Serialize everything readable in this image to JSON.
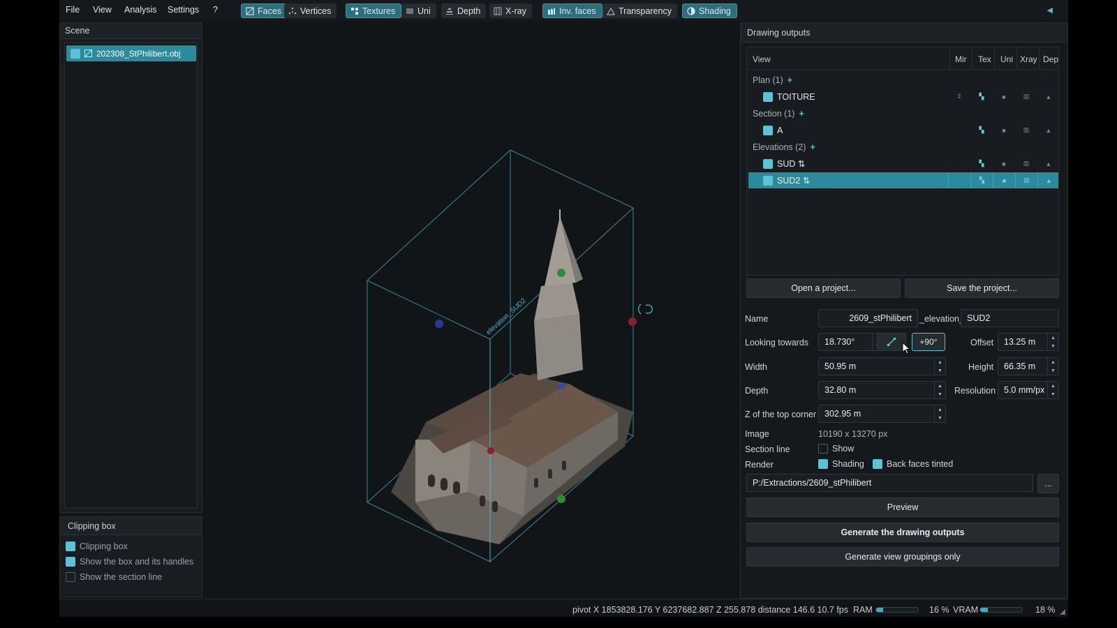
{
  "menu": [
    "File",
    "View",
    "Analysis",
    "Settings",
    "?"
  ],
  "toolbar": {
    "faces": "Faces",
    "vertices": "Vertices",
    "textures": "Textures",
    "uni": "Uni",
    "depth": "Depth",
    "xray": "X-ray",
    "inv_faces": "Inv. faces",
    "transparency": "Transparency",
    "shading": "Shading"
  },
  "scene": {
    "title": "Scene",
    "file": "202308_StPhilibert.obj"
  },
  "clipping": {
    "title": "Clipping box",
    "items": [
      {
        "label": "Clipping box",
        "checked": true
      },
      {
        "label": "Show the box and its handles",
        "checked": true
      },
      {
        "label": "Show the section line",
        "checked": false
      }
    ]
  },
  "viewport": {
    "box_label": "elevation_SUD2"
  },
  "outputs": {
    "title": "Drawing outputs",
    "columns": [
      "View",
      "Mir",
      "Tex",
      "Uni",
      "Xray",
      "Dep"
    ],
    "groups": [
      {
        "label": "Plan (1)",
        "items": [
          {
            "name": "TOITURE",
            "selected": false,
            "has_mirror": true
          }
        ]
      },
      {
        "label": "Section (1)",
        "items": [
          {
            "name": "A",
            "selected": false,
            "has_mirror": false
          }
        ]
      },
      {
        "label": "Elevations (2)",
        "items": [
          {
            "name": "SUD ⇅",
            "selected": false,
            "has_mirror": false
          },
          {
            "name": "SUD2 ⇅",
            "selected": true,
            "has_mirror": false
          }
        ]
      }
    ],
    "open_project": "Open a project...",
    "save_project": "Save the project..."
  },
  "form": {
    "name_label": "Name",
    "name_prefix": "2609_stPhilibert",
    "name_mid": "_elevation_",
    "name_suffix": "SUD2",
    "looking_label": "Looking towards",
    "looking_value": "18.730°",
    "rotate_btn": "+90°",
    "offset_label": "Offset",
    "offset_value": "13.25 m",
    "width_label": "Width",
    "width_value": "50.95 m",
    "height_label": "Height",
    "height_value": "66.35 m",
    "depth_label": "Depth",
    "depth_value": "32.80 m",
    "resolution_label": "Resolution",
    "resolution_value": "5.0 mm/px",
    "ztop_label": "Z of the top corner",
    "ztop_value": "302.95 m",
    "image_label": "Image",
    "image_value": "10190 x 13270 px",
    "section_label": "Section line",
    "section_show": "Show",
    "render_label": "Render",
    "render_shading": "Shading",
    "render_back": "Back faces tinted",
    "path_value": "P:/Extractions/2609_stPhilibert",
    "browse": "...",
    "preview": "Preview",
    "generate": "Generate the drawing outputs",
    "generate_groups": "Generate view groupings only"
  },
  "status": {
    "pivot": "pivot  X 1853828.176  Y 6237682.887  Z 255.878  distance  146.6  10.7 fps",
    "ram_label": "RAM",
    "ram_pct": "16 %",
    "ram_fraction": 0.16,
    "vram_label": "VRAM",
    "vram_pct": "18 %",
    "vram_fraction": 0.18
  },
  "colors": {
    "accent": "#5cc3d6",
    "selection": "#2b8a9c",
    "box": "#4fb8cc"
  }
}
